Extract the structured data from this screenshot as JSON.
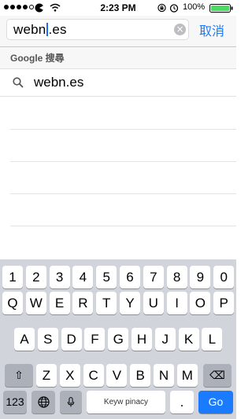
{
  "status_bar": {
    "time": "2:23 PM",
    "battery_percent": "100%",
    "signal_strength": 4,
    "icons": [
      "carrier-logo",
      "wifi-icon",
      "lock-rotation-icon",
      "alarm-icon",
      "battery-icon"
    ]
  },
  "search": {
    "query_before_cursor": "webn",
    "query_after_cursor": ".es",
    "clear_symbol": "×",
    "cancel_label": "取消"
  },
  "suggestions": {
    "section_title": "Google 搜尋",
    "items": [
      {
        "text": "webn.es",
        "icon": "search-icon"
      }
    ]
  },
  "keyboard": {
    "row_numbers": [
      "1",
      "2",
      "3",
      "4",
      "5",
      "6",
      "7",
      "8",
      "9",
      "0"
    ],
    "row_top": [
      "Q",
      "W",
      "E",
      "R",
      "T",
      "Y",
      "U",
      "I",
      "O",
      "P"
    ],
    "row_middle": [
      "A",
      "S",
      "D",
      "F",
      "G",
      "H",
      "J",
      "K",
      "L"
    ],
    "row_bottom": [
      "Z",
      "X",
      "C",
      "V",
      "B",
      "N",
      "M"
    ],
    "shift_symbol": "⇧",
    "delete_symbol": "⌫",
    "numbers_label": "123",
    "space_label": "Keyw pinacy",
    "dot_label": ".",
    "go_label": "Go"
  },
  "colors": {
    "accent": "#1a7bff",
    "keyboard_bg": "#d1d5db",
    "battery_fill": "#4cd964"
  }
}
